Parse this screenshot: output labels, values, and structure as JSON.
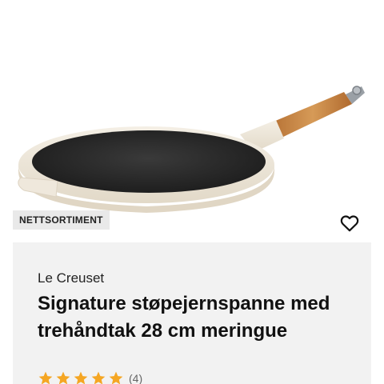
{
  "badge": {
    "label": "NETTSORTIMENT"
  },
  "product": {
    "brand": "Le Creuset",
    "title": "Signature støpejernspanne med trehåndtak 28 cm meringue",
    "rating": {
      "stars": 5,
      "max": 5,
      "count_label": "(4)"
    }
  },
  "icons": {
    "favorite": "heart-outline-icon",
    "star": "star-icon"
  },
  "colors": {
    "star": "#f5a623",
    "pan_body": "#f1ebdf",
    "pan_interior": "#2b2b2b",
    "handle_wood": "#c9853f",
    "card_background": "#f2f2f2",
    "badge_background": "#e9e9e9"
  }
}
